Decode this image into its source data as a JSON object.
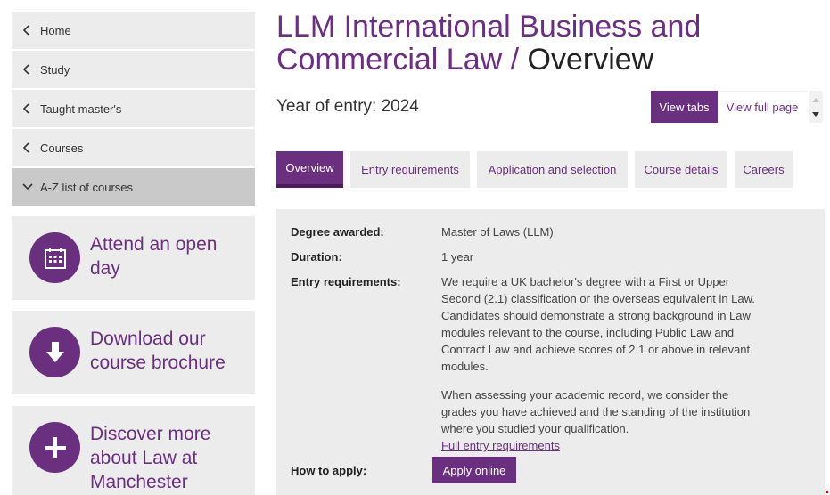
{
  "sidebar": {
    "nav": [
      {
        "label": "Home"
      },
      {
        "label": "Study"
      },
      {
        "label": "Taught master's"
      },
      {
        "label": "Courses"
      },
      {
        "label": "A-Z list of courses",
        "expanded": true
      }
    ],
    "promos": [
      {
        "label": "Attend an open day",
        "line1": "Attend an open",
        "line2": "day",
        "icon": "calendar-icon"
      },
      {
        "label": "Download our course brochure",
        "line1": "Download our",
        "line2": "course brochure",
        "icon": "download-arrow-icon"
      },
      {
        "label": "Discover more about Law at Manchester",
        "line1": "Discover more",
        "line2": "about Law at",
        "line3": "Manchester",
        "icon": "plus-icon"
      }
    ]
  },
  "header": {
    "title_line1": "LLM International Business and",
    "title_line2": "Commercial Law",
    "title_sep": " / ",
    "title_page": "Overview",
    "year": "Year of entry: 2024",
    "view_tabs": "View tabs",
    "view_full": "View full page"
  },
  "tabs": [
    {
      "label": "Overview",
      "active": true
    },
    {
      "label": "Entry requirements"
    },
    {
      "label": "Application and selection"
    },
    {
      "label": "Course details"
    },
    {
      "label": "Careers"
    }
  ],
  "overview": {
    "degree_label": "Degree awarded:",
    "degree_value": "Master of Laws (LLM)",
    "duration_label": "Duration:",
    "duration_value": "1 year",
    "entry_label": "Entry requirements:",
    "entry_p1_lines": [
      "We require a UK bachelor's degree with a First or Upper",
      "Second (2.1) classification or the overseas equivalent in Law.",
      "Candidates should demonstrate a strong background in Law",
      "modules relevant to the course, including Public Law and",
      "Contract Law and achieve scores of 2.1 or above in relevant",
      "modules."
    ],
    "entry_p2_lines": [
      "When assessing your academic record, we consider the",
      "grades you have achieved and the standing of the institution",
      "where you studied your qualification."
    ],
    "entry_link": "Full entry requirements",
    "apply_label": "How to apply:",
    "apply_button": "Apply online"
  },
  "colors": {
    "accent": "#6b2f80",
    "panel": "#ececec"
  }
}
